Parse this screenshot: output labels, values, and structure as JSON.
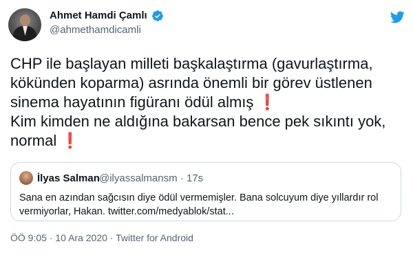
{
  "author": {
    "name": "Ahmet Hamdi Çamlı",
    "handle": "@ahmethamdicamli",
    "verified": true
  },
  "tweet": {
    "lines": [
      "CHP ile başlayan milleti başkalaştırma (gavurlaştırma,",
      "kökünden koparma) asrında önemli bir görev üstlenen",
      "sinema hayatının figüranı ödül almış",
      "Kim kimden ne aldığına bakarsan bence pek sıkıntı yok,",
      "normal"
    ],
    "exclamation": "❗"
  },
  "quote": {
    "name": "İlyas Salman",
    "handle": "@ilyassalmansm",
    "separator": "·",
    "time": "17s",
    "lines": [
      "Sana en azından sağcısın diye ödül vermemişler. Bana solcuyum diye yıllardır rol",
      "vermiyorlar, Hakan. twitter.com/medyablok/stat..."
    ]
  },
  "footer": {
    "time": "ÖÖ 9:05",
    "separator": "·",
    "date": "10 Ara 2020",
    "source": "Twitter for Android"
  },
  "colors": {
    "accent": "#1d9bf0",
    "exclamation": "#dd2e44",
    "text": "#0f1419",
    "muted": "#536471"
  },
  "icons": {
    "logo": "twitter-bird-icon",
    "verified": "verified-badge-icon"
  }
}
